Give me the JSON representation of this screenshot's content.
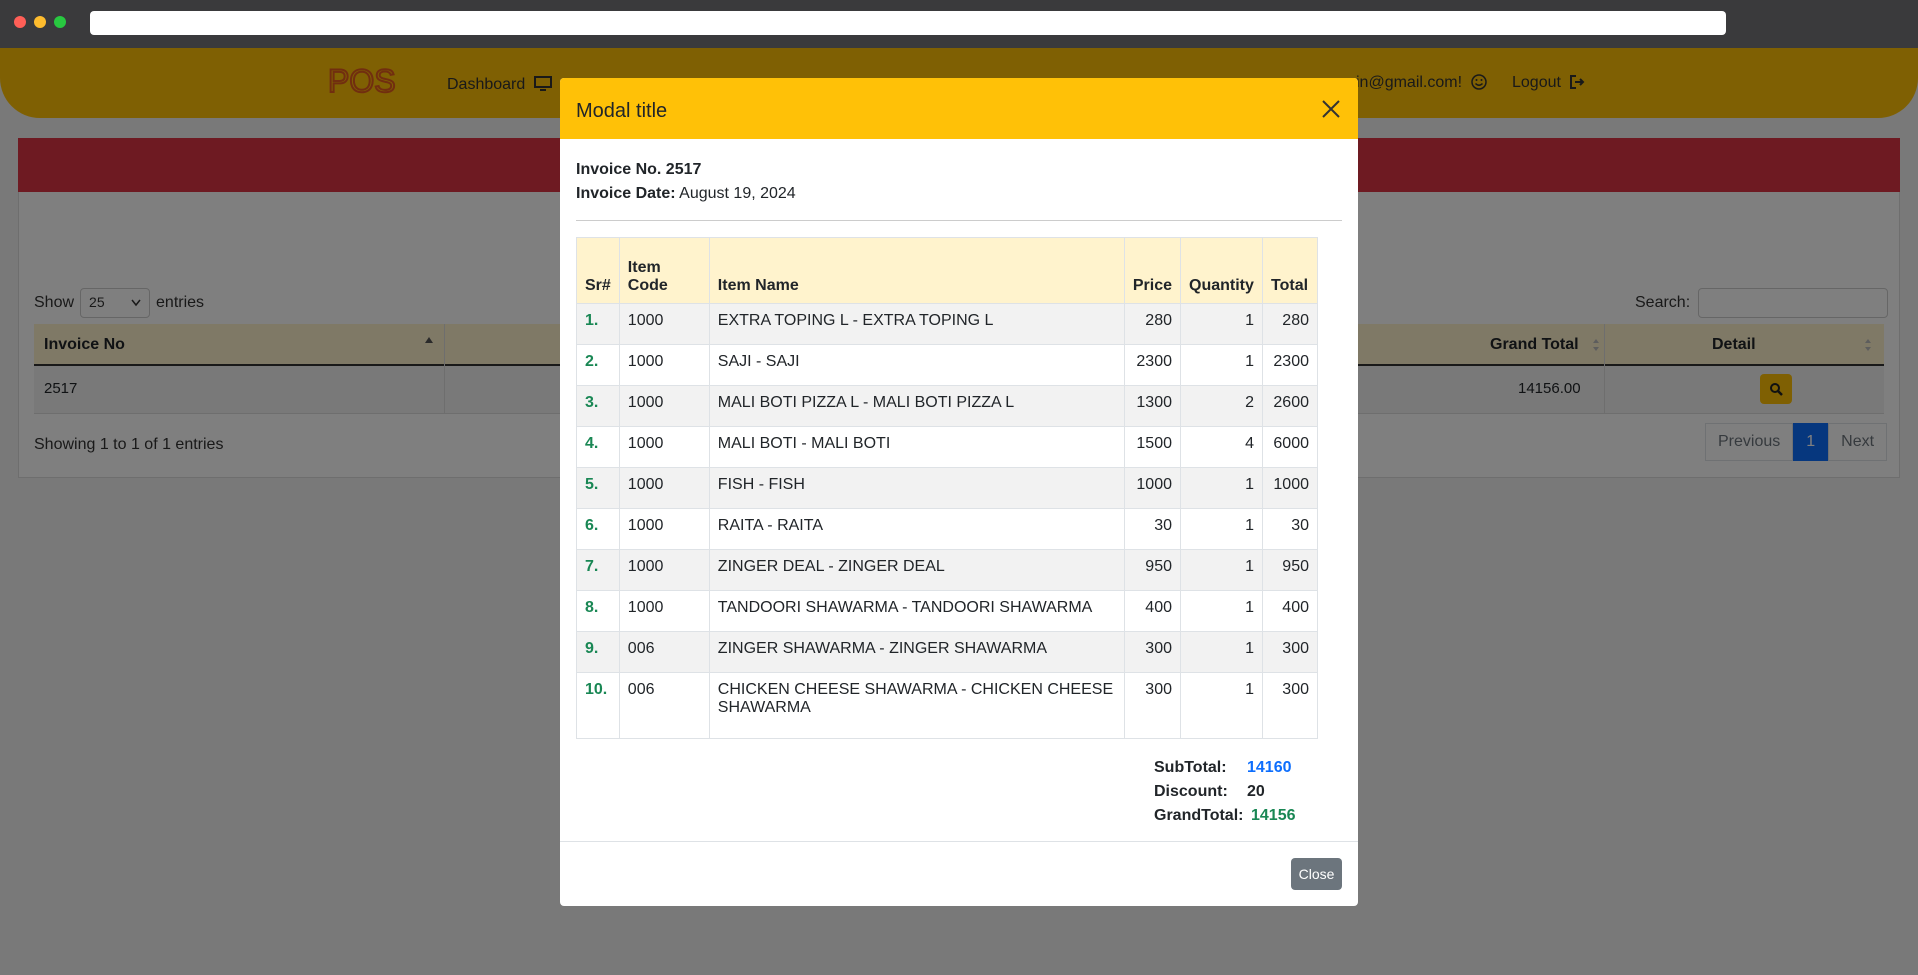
{
  "nav": {
    "logo_text": "POS",
    "dashboard": "Dashboard",
    "email": "in@gmail.com!",
    "logout": "Logout"
  },
  "list": {
    "show_label": "Show",
    "entries_value": "25",
    "entries_label": "entries",
    "search_label": "Search:",
    "columns": {
      "invoice_no": "Invoice No",
      "grand_total": "Grand Total",
      "detail": "Detail"
    },
    "row": {
      "invoice_no": "2517",
      "grand_total": "14156.00"
    },
    "showing": "Showing 1 to 1 of 1 entries",
    "pager": {
      "previous": "Previous",
      "page": "1",
      "next": "Next"
    }
  },
  "modal": {
    "title": "Modal title",
    "invoice_no_label": "Invoice No. 2517",
    "invoice_date_label": "Invoice Date:",
    "invoice_date": "August 19, 2024",
    "columns": {
      "sr": "Sr#",
      "item_code": "Item Code",
      "item_name": "Item Name",
      "price": "Price",
      "quantity": "Quantity",
      "total": "Total"
    },
    "items": [
      {
        "sr": "1.",
        "code": "1000",
        "name": "EXTRA TOPING L - EXTRA TOPING L",
        "price": "280",
        "qty": "1",
        "total": "280"
      },
      {
        "sr": "2.",
        "code": "1000",
        "name": "SAJI - SAJI",
        "price": "2300",
        "qty": "1",
        "total": "2300"
      },
      {
        "sr": "3.",
        "code": "1000",
        "name": "MALI BOTI PIZZA L - MALI BOTI PIZZA L",
        "price": "1300",
        "qty": "2",
        "total": "2600"
      },
      {
        "sr": "4.",
        "code": "1000",
        "name": "MALI BOTI - MALI BOTI",
        "price": "1500",
        "qty": "4",
        "total": "6000"
      },
      {
        "sr": "5.",
        "code": "1000",
        "name": "FISH - FISH",
        "price": "1000",
        "qty": "1",
        "total": "1000"
      },
      {
        "sr": "6.",
        "code": "1000",
        "name": "RAITA - RAITA",
        "price": "30",
        "qty": "1",
        "total": "30"
      },
      {
        "sr": "7.",
        "code": "1000",
        "name": "ZINGER DEAL - ZINGER DEAL",
        "price": "950",
        "qty": "1",
        "total": "950"
      },
      {
        "sr": "8.",
        "code": "1000",
        "name": "TANDOORI SHAWARMA - TANDOORI SHAWARMA",
        "price": "400",
        "qty": "1",
        "total": "400"
      },
      {
        "sr": "9.",
        "code": "006",
        "name": "ZINGER SHAWARMA - ZINGER SHAWARMA",
        "price": "300",
        "qty": "1",
        "total": "300"
      },
      {
        "sr": "10.",
        "code": "006",
        "name": "CHICKEN CHEESE SHAWARMA - CHICKEN CHEESE SHAWARMA",
        "price": "300",
        "qty": "1",
        "total": "300"
      }
    ],
    "totals": {
      "subtotal_label": "SubTotal:",
      "subtotal": "14160",
      "discount_label": "Discount:",
      "discount": "20",
      "grandtotal_label": "GrandTotal:",
      "grandtotal": "14156"
    },
    "close_button": "Close"
  },
  "colors": {
    "accent": "#ffc107",
    "banner": "#dc3545",
    "primary": "#0d6efd",
    "success": "#198754"
  },
  "icons": [
    "monitor-icon",
    "smile-icon",
    "logout-icon",
    "search-icon",
    "close-icon",
    "sort-icon"
  ]
}
